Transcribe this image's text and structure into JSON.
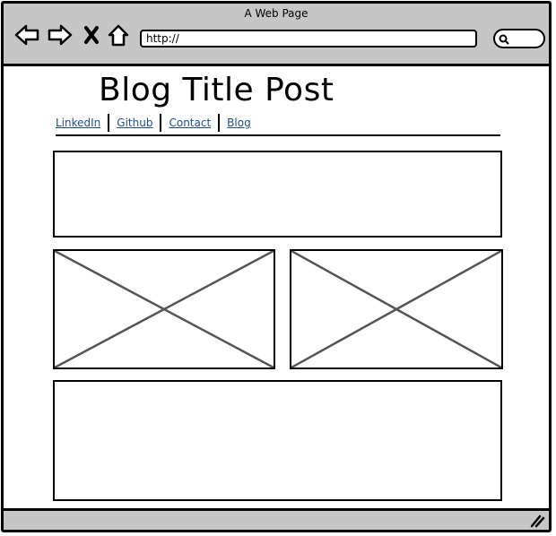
{
  "window": {
    "title": "A Web Page"
  },
  "toolbar": {
    "back_icon": "arrow-left-icon",
    "forward_icon": "arrow-right-icon",
    "stop_icon": "close-icon",
    "home_icon": "home-icon",
    "address": "http://",
    "search_icon": "search-icon"
  },
  "page": {
    "title": "Blog Title Post",
    "nav": [
      "LinkedIn",
      "Github",
      "Contact",
      "Blog"
    ],
    "link_color": "#1f4f8f"
  },
  "colors": {
    "chrome": "#c6c6c6",
    "border": "#000000",
    "placeholder_x": "#555555"
  }
}
